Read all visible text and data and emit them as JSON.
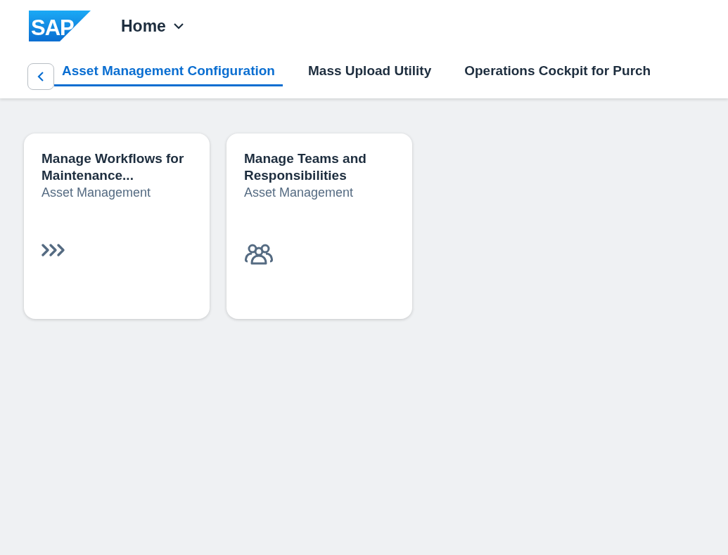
{
  "shell": {
    "logo": "SAP",
    "title": "Home"
  },
  "tabs": [
    {
      "label": "Asset Management Configuration",
      "selected": true
    },
    {
      "label": "Mass Upload Utility",
      "selected": false
    },
    {
      "label": "Operations Cockpit for Purch",
      "selected": false
    }
  ],
  "tiles": [
    {
      "title": "Manage Workflows for Maintenance...",
      "subtitle": "Asset Management",
      "kind": "workflow"
    },
    {
      "title": "Manage Teams and Responsibilities",
      "subtitle": "Asset Management",
      "kind": "team"
    }
  ]
}
